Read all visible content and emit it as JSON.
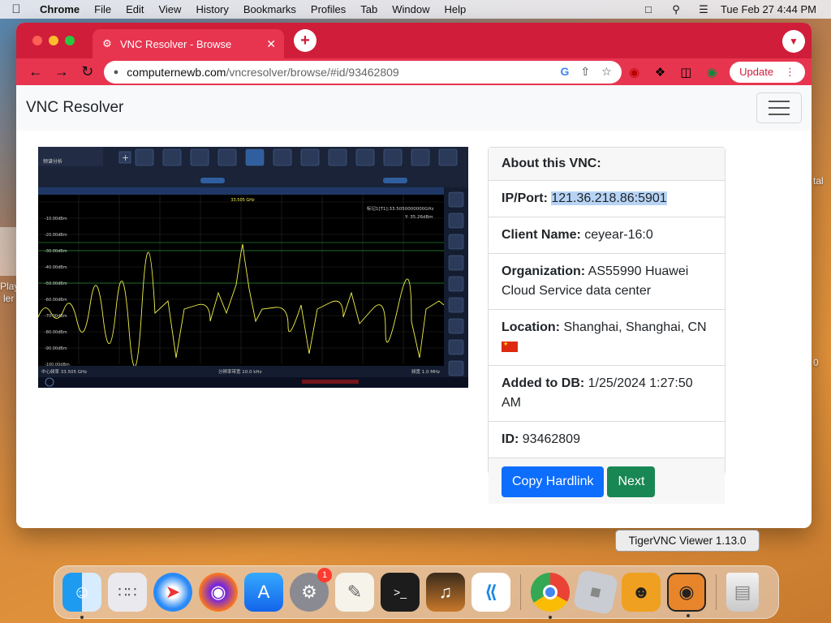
{
  "menubar": {
    "app": "Chrome",
    "items": [
      "File",
      "Edit",
      "View",
      "History",
      "Bookmarks",
      "Profiles",
      "Tab",
      "Window",
      "Help"
    ],
    "clock": "Tue Feb 27  4:44 PM"
  },
  "browser": {
    "tab_title": "VNC Resolver - Browse",
    "url_host": "computernewb.com",
    "url_path": "/vncresolver/browse/#id/93462809",
    "update_label": "Update"
  },
  "page": {
    "brand": "VNC Resolver",
    "card": {
      "header": "About this VNC:",
      "ip_label": "IP/Port:",
      "ip_value": "121.36.218.86:5901",
      "client_label": "Client Name:",
      "client_value": "ceyear-16:0",
      "org_label": "Organization:",
      "org_value": "AS55990 Huawei Cloud Service data center",
      "location_label": "Location:",
      "location_value": "Shanghai, Shanghai, CN",
      "added_label": "Added to DB:",
      "added_value": "1/25/2024 1:27:50 AM",
      "id_label": "ID:",
      "id_value": "93462809",
      "copy_button": "Copy Hardlink",
      "next_button": "Next"
    },
    "vnc_screenshot": {
      "top_left_title": "频谱分析",
      "ref_level": "0.00dBm",
      "marker_text": "标记1[T1]:33.5050000000GHz",
      "marker_value": "Y: 35.26dBm",
      "center_freq": "中心频率 33.505 GHz",
      "rbw": "分辨率带宽 10.0 kHz",
      "span": "频宽 1.0 MHz",
      "y_ticks": [
        "-10.00dBm",
        "-20.00dBm",
        "-30.00dBm",
        "-40.00dBm",
        "-50.00dBm",
        "-60.00dBm",
        "-70.00dBm",
        "-80.00dBm",
        "-90.00dBm",
        "-100.00dBm"
      ]
    }
  },
  "tooltip": "TigerVNC Viewer 1.13.0",
  "dock": {
    "badge_count": "1",
    "apps": [
      "finder-icon",
      "launchpad-icon",
      "safari-icon",
      "firefox-icon",
      "app-store-icon",
      "system-settings-icon",
      "textedit-icon",
      "terminal-icon",
      "garageband-icon",
      "vscode-icon",
      "chrome-icon",
      "roblox-icon",
      "tigervnc-bear-icon",
      "tigervnc-icon",
      "trash-icon"
    ]
  },
  "colors": {
    "chrome_theme": "#cf1d3a",
    "tab_active": "#e8354f",
    "primary": "#0d6efd",
    "success": "#198754",
    "trace": "#f2f24a"
  }
}
